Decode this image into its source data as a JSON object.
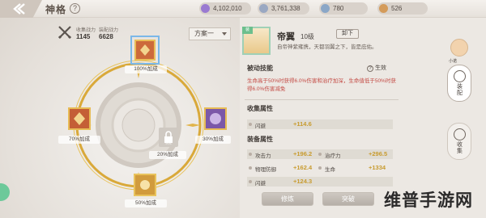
{
  "header": {
    "title": "神格",
    "help": "?",
    "resources": [
      {
        "name": "purple-gem",
        "value": "4,102,010",
        "color": "#9a7ad1"
      },
      {
        "name": "silver-coin",
        "value": "3,761,338",
        "color": "#9aa8c2"
      },
      {
        "name": "shield-token",
        "value": "780",
        "color": "#8ba7c7"
      },
      {
        "name": "gold-bag",
        "value": "526",
        "color": "#d49b5a"
      }
    ]
  },
  "stats": {
    "collect_power_label": "收集战力",
    "collect_power_value": "1145",
    "equip_power_label": "装配战力",
    "equip_power_value": "6628"
  },
  "scheme": {
    "label": "方案一"
  },
  "slots": {
    "top": "100%加成",
    "left": "70%加成",
    "right": "30%加成",
    "center": "20%加成",
    "bottom": "50%加成",
    "center_lock": "锁定"
  },
  "hero": {
    "name": "帝翼",
    "level": "10级",
    "desc": "自帝神紫雍携，天都羽翼之下，皆是庇佑。",
    "unequip": "卸下",
    "badge": "装"
  },
  "passive": {
    "title": "被动技能",
    "effect_flag": "生效",
    "text": "生命高于50%时获得6.0%伤害和治疗加深，生命值低于50%时获得6.0%伤害减免"
  },
  "collect_attr": {
    "title": "收集属性",
    "items": [
      {
        "name": "闪避",
        "value": "+114.6"
      }
    ]
  },
  "equip_attr": {
    "title": "装备属性",
    "items": [
      {
        "name": "攻击力",
        "value": "+196.2"
      },
      {
        "name": "治疗力",
        "value": "+296.5"
      },
      {
        "name": "物理防御",
        "value": "+162.4"
      },
      {
        "name": "生命",
        "value": "+1334"
      },
      {
        "name": "闪避",
        "value": "+124.3"
      }
    ]
  },
  "buttons": {
    "train": "修炼",
    "breakthrough": "突破"
  },
  "side": {
    "avatar_label": "小诺",
    "assemble": "装配",
    "collect": "收集"
  },
  "watermark": "维普手游网"
}
